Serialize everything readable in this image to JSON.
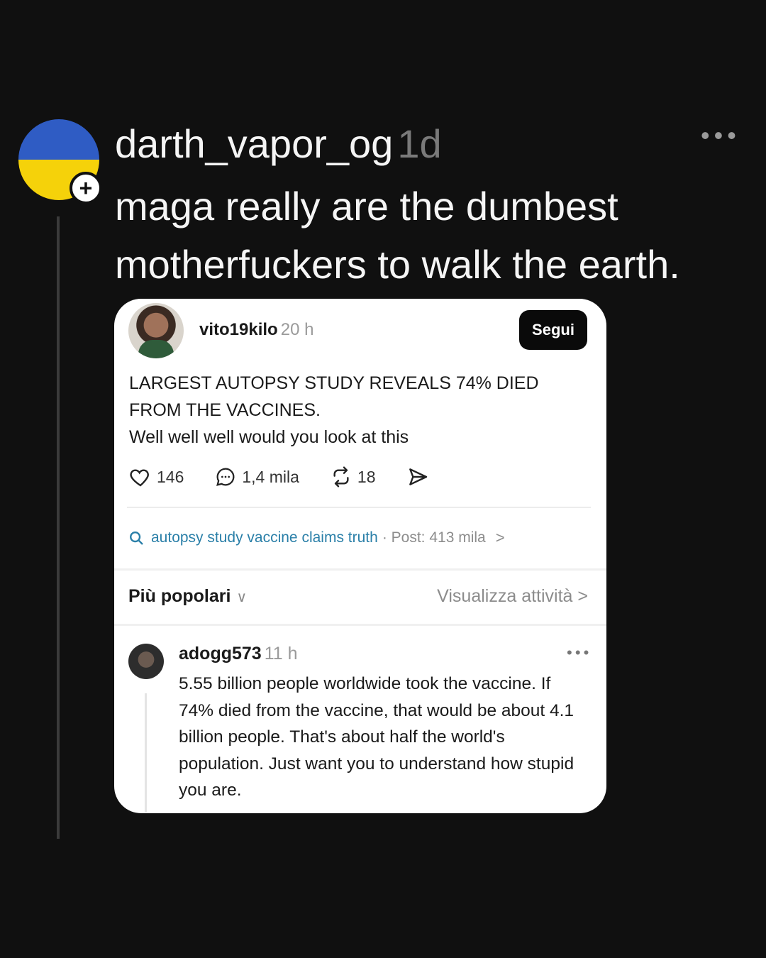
{
  "post": {
    "username": "darth_vapor_og",
    "time": "1d",
    "text": "maga really are the dumbest motherfuckers to walk the earth."
  },
  "embedded": {
    "username": "vito19kilo",
    "time": "20 h",
    "follow_label": "Segui",
    "text_line1": "LARGEST AUTOPSY STUDY REVEALS 74% DIED FROM THE VACCINES.",
    "text_line2": "Well well well would you look at this",
    "likes": "146",
    "comments": "1,4 mila",
    "reposts": "18",
    "topic": "autopsy study vaccine claims truth",
    "topic_meta": "· Post: 413 mila",
    "sort_label": "Più popolari",
    "activity_label": "Visualizza attività",
    "reply": {
      "username": "adogg573",
      "time": "11 h",
      "text": "5.55 billion people worldwide took the vaccine. If 74% died from the vaccine, that would be about 4.1 billion people. That's about half the world's population. Just want you to understand how stupid you are."
    }
  },
  "colors": {
    "background": "#101010",
    "flag_blue": "#2f5cc4",
    "flag_yellow": "#f5d20a",
    "link": "#2a7fa8"
  }
}
